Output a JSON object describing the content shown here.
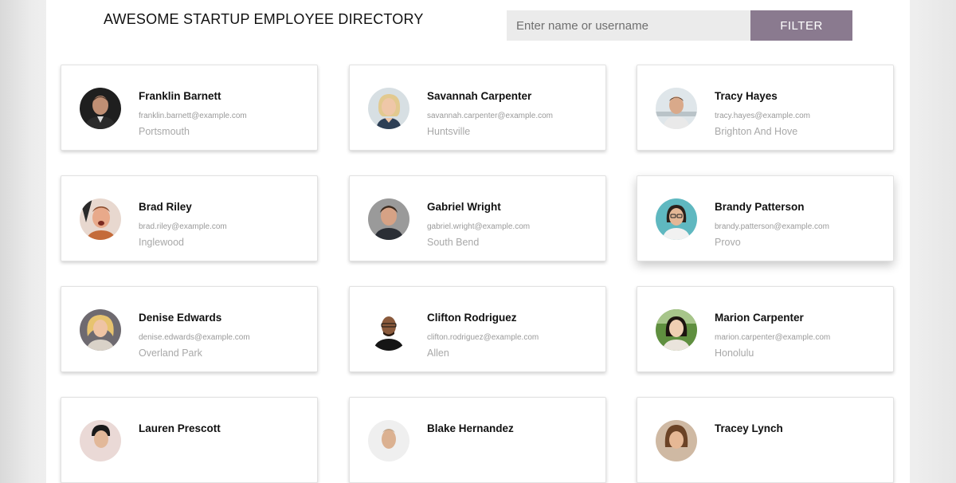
{
  "header": {
    "title": "AWESOME STARTUP EMPLOYEE DIRECTORY",
    "search_placeholder": "Enter name or username",
    "search_value": "",
    "filter_label": "FILTER"
  },
  "colors": {
    "filter_button": "#8a7a8f",
    "search_background": "#ebebeb"
  },
  "employees": [
    {
      "name": "Franklin Barnett",
      "email": "franklin.barnett@example.com",
      "city": "Portsmouth"
    },
    {
      "name": "Savannah Carpenter",
      "email": "savannah.carpenter@example.com",
      "city": "Huntsville"
    },
    {
      "name": "Tracy Hayes",
      "email": "tracy.hayes@example.com",
      "city": "Brighton And Hove"
    },
    {
      "name": "Brad Riley",
      "email": "brad.riley@example.com",
      "city": "Inglewood"
    },
    {
      "name": "Gabriel Wright",
      "email": "gabriel.wright@example.com",
      "city": "South Bend"
    },
    {
      "name": "Brandy Patterson",
      "email": "brandy.patterson@example.com",
      "city": "Provo"
    },
    {
      "name": "Denise Edwards",
      "email": "denise.edwards@example.com",
      "city": "Overland Park"
    },
    {
      "name": "Clifton Rodriguez",
      "email": "clifton.rodriguez@example.com",
      "city": "Allen"
    },
    {
      "name": "Marion Carpenter",
      "email": "marion.carpenter@example.com",
      "city": "Honolulu"
    },
    {
      "name": "Lauren Prescott",
      "email": "",
      "city": ""
    },
    {
      "name": "Blake Hernandez",
      "email": "",
      "city": ""
    },
    {
      "name": "Tracey Lynch",
      "email": "",
      "city": ""
    }
  ]
}
